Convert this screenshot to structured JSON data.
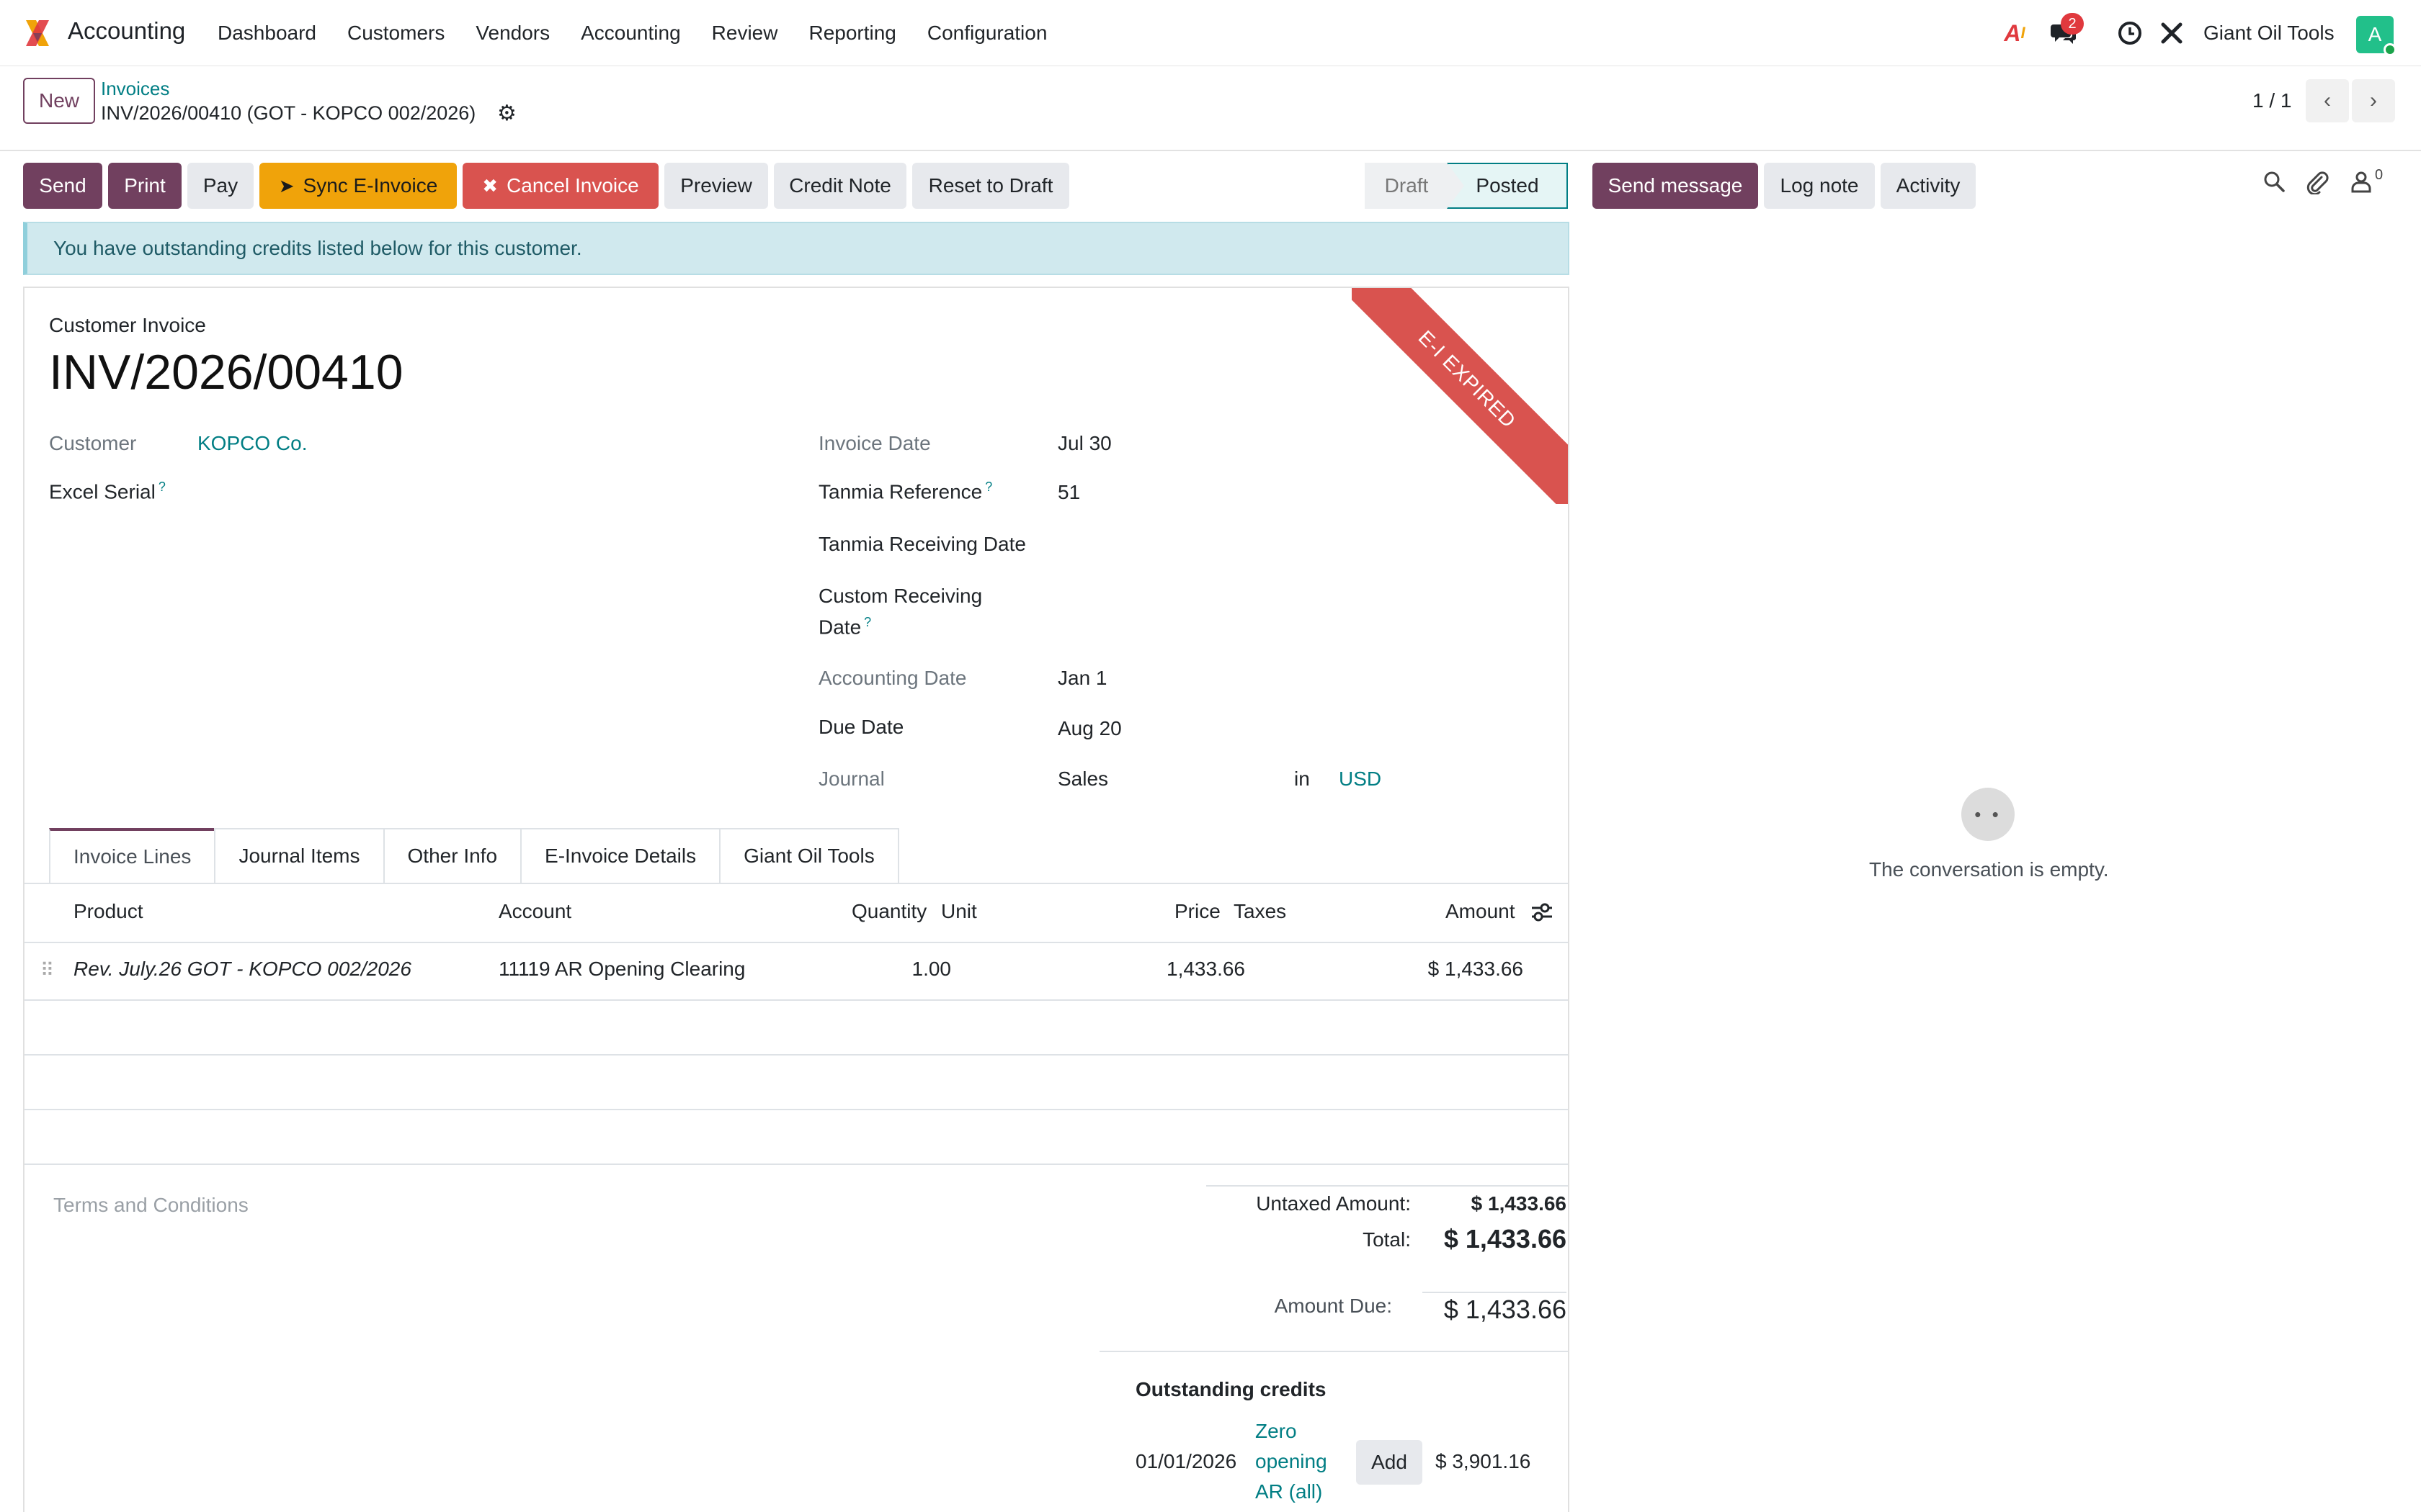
{
  "app": {
    "name": "Accounting"
  },
  "menu": [
    "Dashboard",
    "Customers",
    "Vendors",
    "Accounting",
    "Review",
    "Reporting",
    "Configuration"
  ],
  "systray": {
    "message_count": "2",
    "company": "Giant Oil Tools",
    "avatar_letter": "A"
  },
  "control": {
    "new_label": "New",
    "breadcrumb": "Invoices",
    "record": "INV/2026/00410 (GOT - KOPCO 002/2026)",
    "pager": "1 / 1"
  },
  "actions": {
    "send": "Send",
    "print": "Print",
    "pay": "Pay",
    "sync": "Sync E-Invoice",
    "cancel": "Cancel Invoice",
    "preview": "Preview",
    "credit_note": "Credit Note",
    "reset": "Reset to Draft"
  },
  "status": {
    "draft": "Draft",
    "posted": "Posted"
  },
  "alert": "You have outstanding credits listed below for this customer.",
  "invoice": {
    "type": "Customer Invoice",
    "name": "INV/2026/00410",
    "ribbon": "E-I EXPIRED",
    "customer_label": "Customer",
    "customer": "KOPCO Co.",
    "excel_serial_label": "Excel Serial",
    "invoice_date_label": "Invoice Date",
    "invoice_date": "Jul 30",
    "tanmia_ref_label": "Tanmia Reference",
    "tanmia_ref": "51",
    "tanmia_recv_label": "Tanmia Receiving Date",
    "custom_recv_label_1": "Custom Receiving",
    "custom_recv_label_2": "Date",
    "accounting_date_label": "Accounting Date",
    "accounting_date": "Jan 1",
    "due_date_label": "Due Date",
    "due_date": "Aug 20",
    "journal_label": "Journal",
    "journal": "Sales",
    "in_label": "in",
    "currency": "USD"
  },
  "tabs": [
    "Invoice Lines",
    "Journal Items",
    "Other Info",
    "E-Invoice Details",
    "Giant Oil Tools"
  ],
  "table": {
    "headers": {
      "product": "Product",
      "account": "Account",
      "quantity": "Quantity",
      "unit": "Unit",
      "price": "Price",
      "taxes": "Taxes",
      "amount": "Amount"
    },
    "rows": [
      {
        "product": "Rev. July.26 GOT - KOPCO 002/2026",
        "account": "11119 AR Opening Clearing",
        "quantity": "1.00",
        "price": "1,433.66",
        "amount": "$ 1,433.66"
      }
    ]
  },
  "terms_placeholder": "Terms and Conditions",
  "totals": {
    "untaxed_label": "Untaxed Amount:",
    "untaxed": "$ 1,433.66",
    "total_label": "Total:",
    "total": "$ 1,433.66",
    "due_label": "Amount Due:",
    "due": "$ 1,433.66"
  },
  "credits": {
    "title": "Outstanding credits",
    "date": "01/01/2026",
    "name_1": "Zero",
    "name_2": "opening",
    "name_3": "AR (all)",
    "add": "Add",
    "amount": "$ 3,901.16"
  },
  "chatter": {
    "send_message": "Send message",
    "log_note": "Log note",
    "activity": "Activity",
    "followers": "0",
    "empty": "The conversation is empty."
  },
  "colors": {
    "primary": "#71405f",
    "link": "#017e84",
    "warning": "#f0a30a",
    "danger": "#d9534f"
  }
}
